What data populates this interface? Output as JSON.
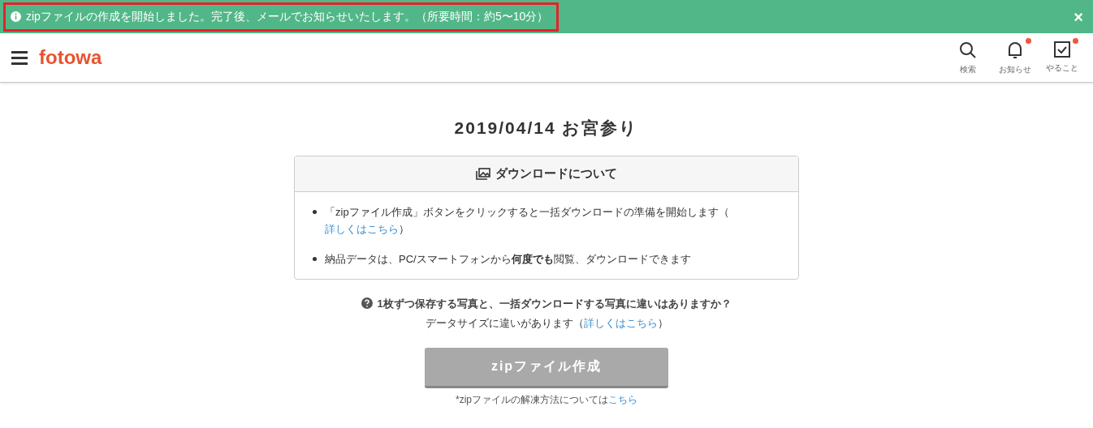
{
  "notification": {
    "text": "zipファイルの作成を開始しました。完了後、メールでお知らせいたします。（所要時間：約5〜10分）",
    "close": "×"
  },
  "header": {
    "logo": "fotowa",
    "actions": [
      {
        "kind": "search",
        "label": "検索",
        "unread": false
      },
      {
        "kind": "bell",
        "label": "お知らせ",
        "unread": true
      },
      {
        "kind": "todo",
        "label": "やること",
        "unread": true
      }
    ]
  },
  "title": "2019/04/14 お宮参り",
  "info_card": {
    "title": "ダウンロードについて",
    "items": [
      {
        "text": "「zipファイル作成」ボタンをクリックすると一括ダウンロードの準備を開始します",
        "open": "（",
        "link": "詳しくはこちら",
        "close": "）"
      },
      {
        "text": "納品データは、PC/スマートフォンから**何度でも**閲覧、ダウンロードできます"
      }
    ]
  },
  "faq": {
    "question": "1枚ずつ保存する写真と、一括ダウンロードする写真に違いはありますか？",
    "answer": "データサイズに違いがあります",
    "open": "（",
    "link": "詳しくはこちら",
    "close": "）"
  },
  "button": {
    "label": "zipファイル作成",
    "disabled": true
  },
  "footnote": {
    "text": "*zipファイルの解凍方法については",
    "link": "こちら"
  }
}
